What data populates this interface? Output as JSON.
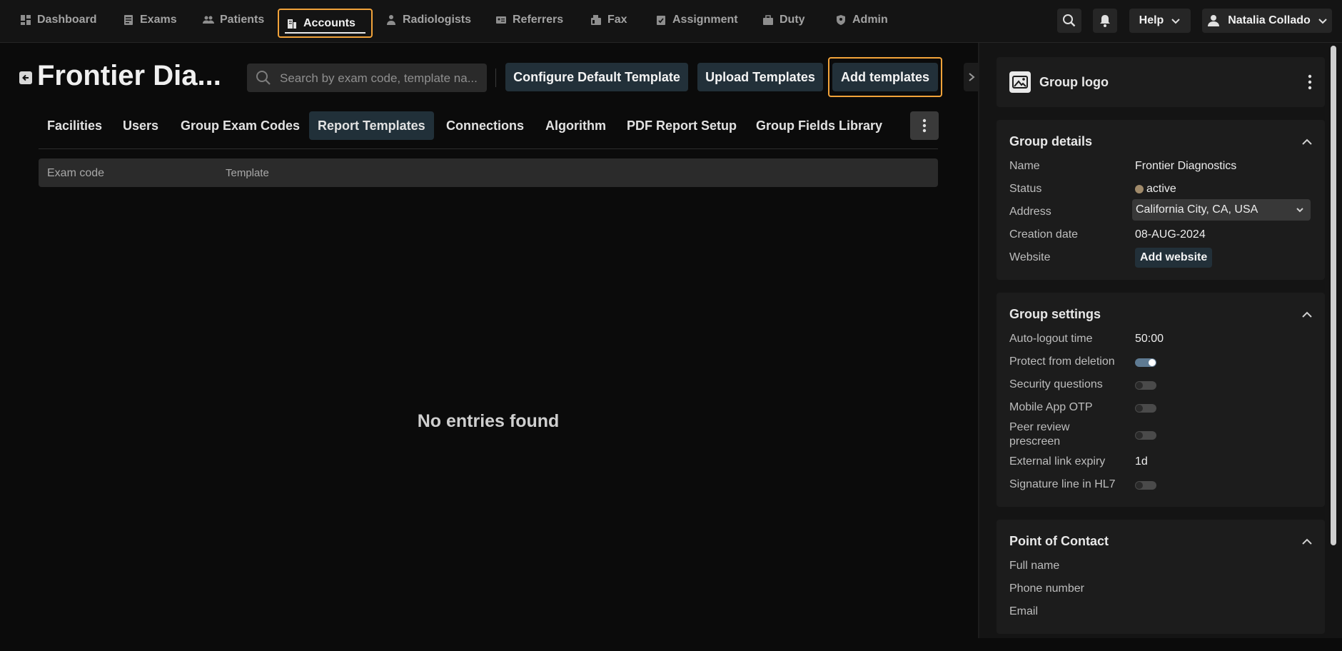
{
  "nav": {
    "items": [
      {
        "label": "Dashboard"
      },
      {
        "label": "Exams"
      },
      {
        "label": "Patients"
      },
      {
        "label": "Accounts"
      },
      {
        "label": "Radiologists"
      },
      {
        "label": "Referrers"
      },
      {
        "label": "Fax"
      },
      {
        "label": "Assignment"
      },
      {
        "label": "Duty"
      },
      {
        "label": "Admin"
      }
    ],
    "help_label": "Help",
    "user_name": "Natalia Collado"
  },
  "header": {
    "title": "Frontier Dia...",
    "search_placeholder": "Search by exam code, template na...",
    "configure_label": "Configure Default Template",
    "upload_label": "Upload Templates",
    "add_label": "Add templates"
  },
  "tabs": [
    {
      "label": "Facilities"
    },
    {
      "label": "Users"
    },
    {
      "label": "Group Exam Codes"
    },
    {
      "label": "Report Templates"
    },
    {
      "label": "Connections"
    },
    {
      "label": "Algorithm"
    },
    {
      "label": "PDF Report Setup"
    },
    {
      "label": "Group Fields Library"
    }
  ],
  "table": {
    "columns": [
      "Exam code",
      "Template"
    ],
    "empty_text": "No entries found"
  },
  "panel": {
    "logo_title": "Group logo",
    "details": {
      "title": "Group details",
      "name_label": "Name",
      "name_value": "Frontier Diagnostics",
      "status_label": "Status",
      "status_value": "active",
      "address_label": "Address",
      "address_value": "California City, CA, USA",
      "creation_label": "Creation date",
      "creation_value": "08-AUG-2024",
      "website_label": "Website",
      "website_button": "Add website"
    },
    "settings": {
      "title": "Group settings",
      "autologout_label": "Auto-logout time",
      "autologout_value": "50:00",
      "protect_label": "Protect from deletion",
      "protect_on": true,
      "security_label": "Security questions",
      "security_on": false,
      "otp_label": "Mobile App OTP",
      "otp_on": false,
      "peer_label_1": "Peer review",
      "peer_label_2": "prescreen",
      "peer_on": false,
      "expiry_label": "External link expiry",
      "expiry_value": "1d",
      "signature_label": "Signature line in HL7",
      "signature_on": false
    },
    "contact": {
      "title": "Point of Contact",
      "fullname_label": "Full name",
      "phone_label": "Phone number",
      "email_label": "Email"
    }
  },
  "colors": {
    "accent_outline": "#f2a33a",
    "button_bg": "#223039",
    "status_dot": "#a08a6a"
  }
}
